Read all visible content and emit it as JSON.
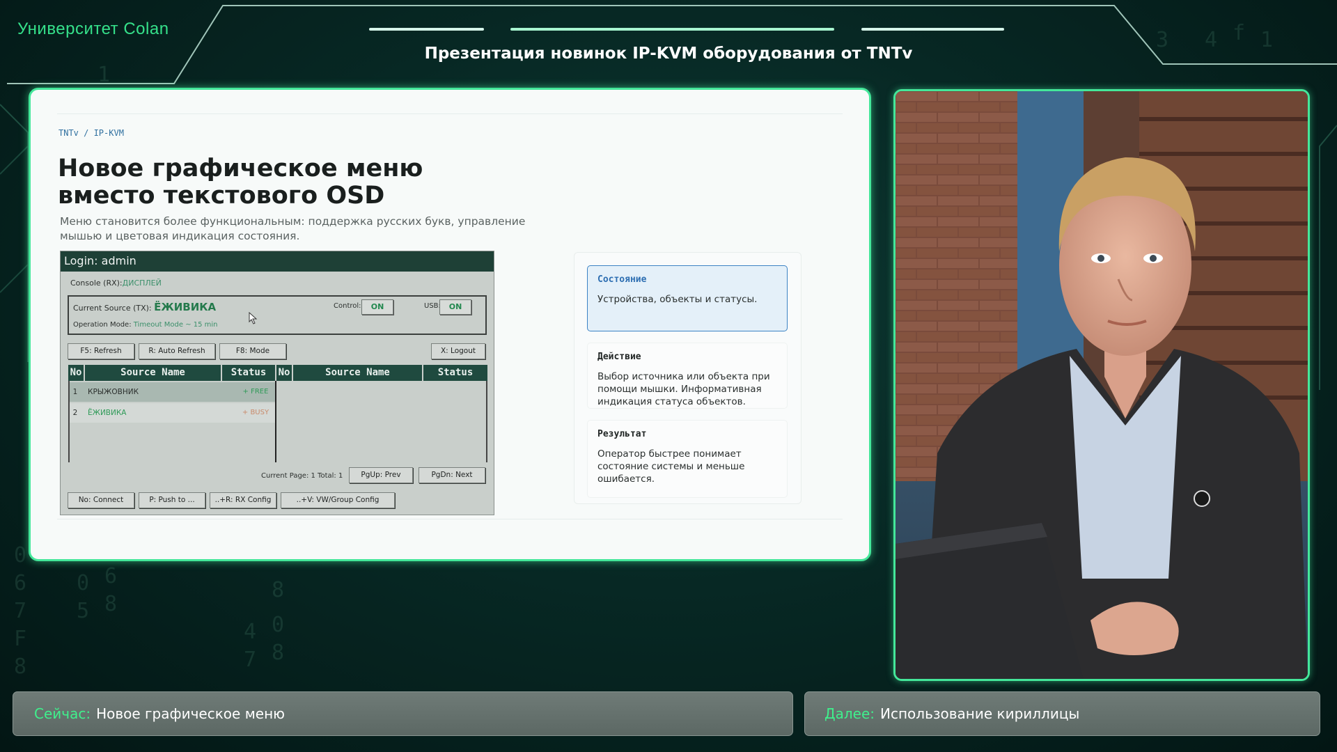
{
  "brand": "Университет Colan",
  "header_title": "Презентация новинок IP-KVM оборудования от TNTv",
  "slide": {
    "breadcrumb": "TNTv / IP-KVM",
    "title_line1": "Новое графическое меню",
    "title_line2": "вместо текстового OSD",
    "subtitle_line1": "Меню становится более функциональным: поддержка русских букв, управление",
    "subtitle_line2": "мышью и цветовая индикация состояния."
  },
  "osd": {
    "login": "Login: admin",
    "console_label": "Console (RX):",
    "console_value": "ДИСПЛЕЙ",
    "current_source_label": "Current Source (TX):",
    "current_source_value": "ЁЖИВИКА",
    "operation_mode_label": "Operation Mode:",
    "operation_mode_value": "Timeout Mode ~ 15 min",
    "control_label": "Control:",
    "control_value": "ON",
    "usb_label": "USB:",
    "usb_value": "ON",
    "buttons_top": [
      "F5: Refresh",
      "R: Auto Refresh",
      "F8: Mode",
      "X: Logout"
    ],
    "columns": [
      "No",
      "Source Name",
      "Status",
      "No",
      "Source Name",
      "Status"
    ],
    "rows": [
      {
        "no": "1",
        "name": "КРЫЖОВНИК",
        "status": "+ FREE"
      },
      {
        "no": "2",
        "name": "ЁЖИВИКА",
        "status": "+ BUSY"
      }
    ],
    "page_info": "Current Page: 1 Total: 1",
    "pgup": "PgUp: Prev",
    "pgdn": "PgDn: Next",
    "buttons_bottom": [
      "No: Connect",
      "P: Push to ...",
      "..+R: RX Config",
      "..+V: VW/Group Config"
    ]
  },
  "cards": [
    {
      "title": "Состояние",
      "body": "Устройства, объекты и статусы.",
      "active": true
    },
    {
      "title": "Действие",
      "body": "Выбор источника или объекта при помощи мышки. Информативная индикация статуса объектов.",
      "active": false
    },
    {
      "title": "Результат",
      "body": "Оператор быстрее понимает состояние системы и меньше ошибается.",
      "active": false
    }
  ],
  "footer": {
    "now_label": "Сейчас:",
    "now_value": "Новое графическое меню",
    "next_label": "Далее:",
    "next_value": "Использование кириллицы"
  },
  "colors": {
    "accent_green": "#44e79a",
    "background": "#072824",
    "active_card_border": "#3b82c4",
    "osd_header": "#1e4036",
    "free_status": "#2e9a57",
    "busy_status": "#c98a6a"
  }
}
